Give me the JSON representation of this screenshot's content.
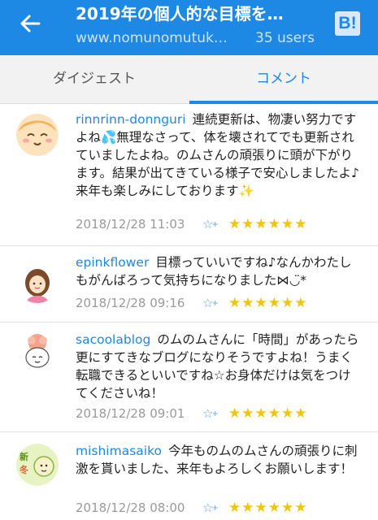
{
  "appbar": {
    "title": "2019年の個人的な目標を…",
    "url": "www.nomunomutuk…",
    "users": "35 users",
    "hatena_button": "B!"
  },
  "tabs": [
    {
      "label": "ダイジェスト",
      "active": false
    },
    {
      "label": "コメント",
      "active": true
    }
  ],
  "comments": [
    {
      "user": "rinnrinn-donnguri",
      "text": "連続更新は、物凄い努力ですよね💦無理なさって、体を壊されてでも更新されていましたよね。のムさんの頑張りに頭が下がります。結果が出てきている様子で安心しましたよ♪来年も楽しみにしております✨",
      "date": "2018/12/28 11:03",
      "stars": "★★★★★★"
    },
    {
      "user": "epinkflower",
      "text": "目標っていいですね♪なんかわたしもがんばろって気持ちになりました⋈◡̈*",
      "date": "2018/12/28 09:16",
      "stars": "★★★★★★"
    },
    {
      "user": "sacoolablog",
      "text": "のムのムさんに「時間」があったら更にすてきなブログになりそうですよね！うまく転職できるといいですね☆お身体だけは気をつけてくださいね！",
      "date": "2018/12/28 09:01",
      "stars": "★★★★★★"
    },
    {
      "user": "mishimasaiko",
      "text": "今年ものムのムさんの頑張りに刺激を貰いました、来年もよろしくお願いします！",
      "date": "2018/12/28 08:00",
      "stars": "★★★★★★"
    }
  ],
  "colors": {
    "accent": "#1e88e5",
    "star": "#f2c40c",
    "date": "#9a9a9a"
  },
  "icons": [
    "back-arrow-icon",
    "hatena-bookmark-icon",
    "add-star-icon",
    "star-icon"
  ]
}
